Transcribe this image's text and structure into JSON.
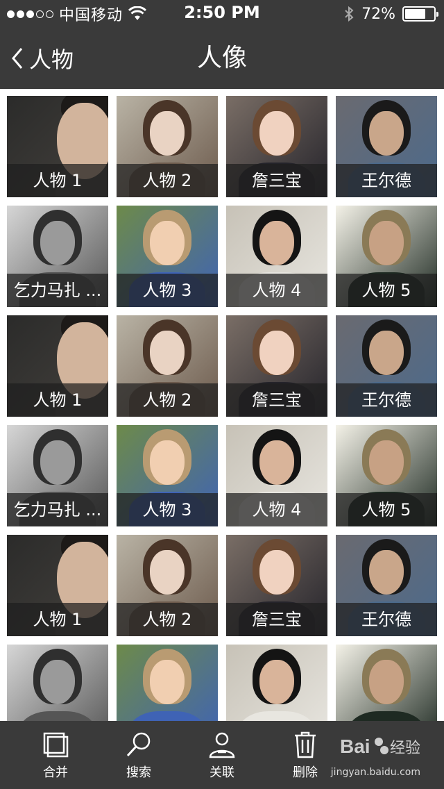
{
  "status_bar": {
    "signal_dots": [
      true,
      true,
      true,
      false,
      false
    ],
    "carrier": "中国移动",
    "time": "2:50 PM",
    "battery_percent_text": "72%",
    "battery_level": 0.72
  },
  "nav": {
    "back_label": "人物",
    "title": "人像"
  },
  "photos": [
    {
      "label": "人物 1",
      "palette": [
        "#2b2b2a",
        "#d2b49c",
        "#1d1a18",
        "#44413d"
      ],
      "style": "side"
    },
    {
      "label": "人物 2",
      "palette": [
        "#b9b3a5",
        "#e9d3c3",
        "#4a3528",
        "#6c5a4c"
      ],
      "style": "center"
    },
    {
      "label": "詹三宝",
      "palette": [
        "#7a6e66",
        "#f0d2c0",
        "#6b4a33",
        "#24232a"
      ],
      "style": "center"
    },
    {
      "label": "王尔德",
      "palette": [
        "#6a6a70",
        "#c9a68a",
        "#1a1a1a",
        "#4c6a8c"
      ],
      "style": "center"
    },
    {
      "label": "乞力马扎 ...",
      "palette": [
        "#d6d6d6",
        "#9a9a9a",
        "#2f2f2f",
        "#555555"
      ],
      "style": "center"
    },
    {
      "label": "人物 3",
      "palette": [
        "#6d8a4a",
        "#f1cfb1",
        "#b99b72",
        "#3f63b5"
      ],
      "style": "center"
    },
    {
      "label": "人物 4",
      "palette": [
        "#c7c2b7",
        "#d9b49a",
        "#141414",
        "#e8e6e0"
      ],
      "style": "center"
    },
    {
      "label": "人物 5",
      "palette": [
        "#f4f2e8",
        "#c7a184",
        "#8a7a56",
        "#1e2a22"
      ],
      "style": "center"
    },
    {
      "label": "人物 1",
      "palette": [
        "#2b2b2a",
        "#d2b49c",
        "#1d1a18",
        "#44413d"
      ],
      "style": "side"
    },
    {
      "label": "人物 2",
      "palette": [
        "#b9b3a5",
        "#e9d3c3",
        "#4a3528",
        "#6c5a4c"
      ],
      "style": "center"
    },
    {
      "label": "詹三宝",
      "palette": [
        "#7a6e66",
        "#f0d2c0",
        "#6b4a33",
        "#24232a"
      ],
      "style": "center"
    },
    {
      "label": "王尔德",
      "palette": [
        "#6a6a70",
        "#c9a68a",
        "#1a1a1a",
        "#4c6a8c"
      ],
      "style": "center"
    },
    {
      "label": "乞力马扎 ...",
      "palette": [
        "#d6d6d6",
        "#9a9a9a",
        "#2f2f2f",
        "#555555"
      ],
      "style": "center"
    },
    {
      "label": "人物 3",
      "palette": [
        "#6d8a4a",
        "#f1cfb1",
        "#b99b72",
        "#3f63b5"
      ],
      "style": "center"
    },
    {
      "label": "人物 4",
      "palette": [
        "#c7c2b7",
        "#d9b49a",
        "#141414",
        "#e8e6e0"
      ],
      "style": "center"
    },
    {
      "label": "人物 5",
      "palette": [
        "#f4f2e8",
        "#c7a184",
        "#8a7a56",
        "#1e2a22"
      ],
      "style": "center"
    },
    {
      "label": "人物 1",
      "palette": [
        "#2b2b2a",
        "#d2b49c",
        "#1d1a18",
        "#44413d"
      ],
      "style": "side"
    },
    {
      "label": "人物 2",
      "palette": [
        "#b9b3a5",
        "#e9d3c3",
        "#4a3528",
        "#6c5a4c"
      ],
      "style": "center"
    },
    {
      "label": "詹三宝",
      "palette": [
        "#7a6e66",
        "#f0d2c0",
        "#6b4a33",
        "#24232a"
      ],
      "style": "center"
    },
    {
      "label": "王尔德",
      "palette": [
        "#6a6a70",
        "#c9a68a",
        "#1a1a1a",
        "#4c6a8c"
      ],
      "style": "center"
    },
    {
      "label": "",
      "palette": [
        "#d6d6d6",
        "#9a9a9a",
        "#2f2f2f",
        "#555555"
      ],
      "style": "center"
    },
    {
      "label": "",
      "palette": [
        "#6d8a4a",
        "#f1cfb1",
        "#b99b72",
        "#3f63b5"
      ],
      "style": "center"
    },
    {
      "label": "",
      "palette": [
        "#c7c2b7",
        "#d9b49a",
        "#141414",
        "#e8e6e0"
      ],
      "style": "center"
    },
    {
      "label": "",
      "palette": [
        "#f4f2e8",
        "#c7a184",
        "#8a7a56",
        "#1e2a22"
      ],
      "style": "center"
    }
  ],
  "tab_bar": {
    "tabs": [
      {
        "label": "合并",
        "icon": "merge-icon"
      },
      {
        "label": "搜索",
        "icon": "search-icon"
      },
      {
        "label": "关联",
        "icon": "person-link-icon"
      },
      {
        "label": "删除",
        "icon": "trash-icon"
      }
    ]
  },
  "watermark": {
    "text": "jingyan.baidu.com"
  }
}
